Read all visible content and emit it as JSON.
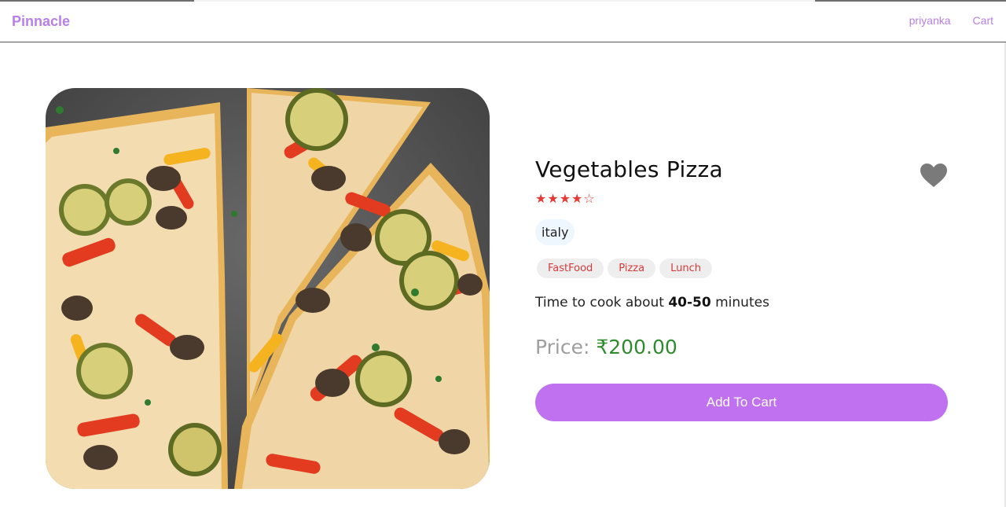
{
  "navbar": {
    "brand": "Pinnacle",
    "links": [
      "priyanka",
      "Cart"
    ]
  },
  "product": {
    "name": "Vegetables Pizza",
    "rating": 4,
    "max_rating": 5,
    "origin": "italy",
    "tags": [
      "FastFood",
      "Pizza",
      "Lunch"
    ],
    "cook_time_prefix": "Time to cook about",
    "cook_time_value": "40-50",
    "cook_time_suffix": "minutes",
    "price_label": "Price:",
    "price_value": "₹200.00",
    "add_to_cart_label": "Add To Cart",
    "favorite": false
  },
  "colors": {
    "accent": "#c071ef",
    "brand_text": "#b87fe9",
    "star": "#e53935",
    "price": "#2e8b2e",
    "tag_text": "#d83a3a"
  },
  "icons": {
    "favorite": "heart-icon",
    "star": "star-icon"
  }
}
